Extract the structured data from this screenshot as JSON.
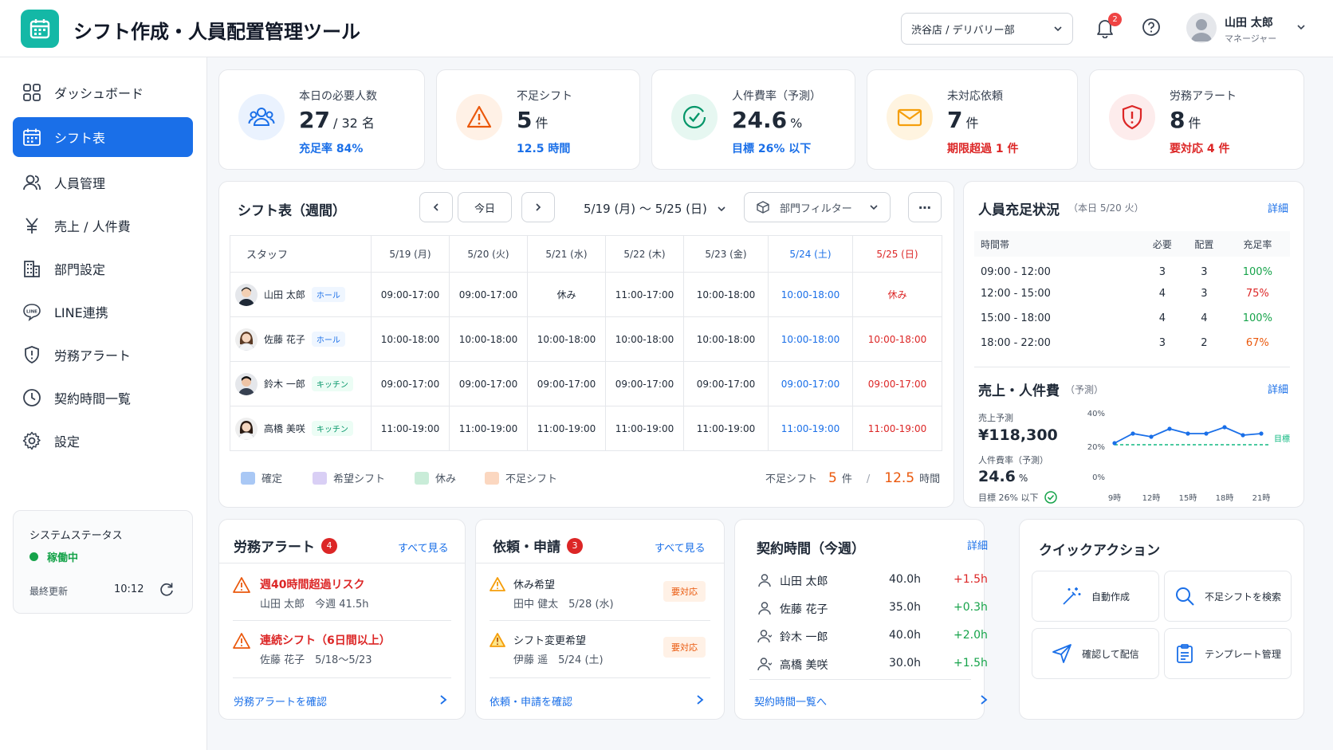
{
  "header": {
    "title": "シフト作成・人員配置管理ツール",
    "store": "渋谷店 / デリバリー部",
    "notification_count": "2",
    "user_name": "山田 太郎",
    "user_role": "マネージャー"
  },
  "sidebar": {
    "items": [
      {
        "label": "ダッシュボード",
        "icon": "dashboard-icon"
      },
      {
        "label": "シフト表",
        "icon": "calendar-icon",
        "active": true
      },
      {
        "label": "人員管理",
        "icon": "users-icon"
      },
      {
        "label": "売上 / 人件費",
        "icon": "yen-icon"
      },
      {
        "label": "部門設定",
        "icon": "building-icon"
      },
      {
        "label": "LINE連携",
        "icon": "line-icon"
      },
      {
        "label": "労務アラート",
        "icon": "shield-icon"
      },
      {
        "label": "契約時間一覧",
        "icon": "clock-icon"
      },
      {
        "label": "設定",
        "icon": "gear-icon"
      }
    ],
    "system": {
      "title": "システムステータス",
      "status": "稼働中",
      "updated_label": "最終更新",
      "updated_time": "10:12"
    }
  },
  "kpis": [
    {
      "label": "本日の必要人数",
      "value": "27",
      "unit": "/ 32 名",
      "sub": "充足率 84%",
      "color": "#1a6fe8",
      "icon": "users-icon"
    },
    {
      "label": "不足シフト",
      "value": "5",
      "unit": "件",
      "sub": "12.5 時間",
      "color": "#1a6fe8",
      "icon": "warning-icon"
    },
    {
      "label": "人件費率（予測）",
      "value": "24.6",
      "unit": "%",
      "sub": "目標 26% 以下",
      "color": "#1a6fe8",
      "icon": "check-badge-icon"
    },
    {
      "label": "未対応依頼",
      "value": "7",
      "unit": "件",
      "sub": "期限超過 1 件",
      "color": "#dc2626",
      "icon": "mail-icon"
    },
    {
      "label": "労務アラート",
      "value": "8",
      "unit": "件",
      "sub": "要対応 4 件",
      "color": "#dc2626",
      "icon": "shield-alert-icon"
    }
  ],
  "schedule": {
    "title": "シフト表（週間）",
    "today": "今日",
    "range": "5/19 (月) 〜 5/25 (日)",
    "filter": "部門フィルター",
    "columns": [
      "スタッフ",
      "5/19 (月)",
      "5/20 (火)",
      "5/21 (水)",
      "5/22 (木)",
      "5/23 (金)",
      "5/24 (土)",
      "5/25 (日)"
    ],
    "rows": [
      {
        "name": "山田 太郎",
        "dept": "ホール",
        "shifts": [
          "09:00-17:00",
          "09:00-17:00",
          "休み",
          "11:00-17:00",
          "10:00-18:00",
          "10:00-18:00",
          "休み"
        ]
      },
      {
        "name": "佐藤 花子",
        "dept": "ホール",
        "shifts": [
          "10:00-18:00",
          "10:00-18:00",
          "10:00-18:00",
          "10:00-18:00",
          "10:00-18:00",
          "10:00-18:00",
          "10:00-18:00"
        ]
      },
      {
        "name": "鈴木 一郎",
        "dept": "キッチン",
        "shifts": [
          "09:00-17:00",
          "09:00-17:00",
          "09:00-17:00",
          "09:00-17:00",
          "09:00-17:00",
          "09:00-17:00",
          "09:00-17:00"
        ]
      },
      {
        "name": "高橋 美咲",
        "dept": "キッチン",
        "shifts": [
          "11:00-19:00",
          "11:00-19:00",
          "11:00-19:00",
          "11:00-19:00",
          "11:00-19:00",
          "11:00-19:00",
          "11:00-19:00"
        ]
      }
    ],
    "legend": [
      {
        "label": "確定",
        "color": "#a9c8f5"
      },
      {
        "label": "希望シフト",
        "color": "#d9cff5"
      },
      {
        "label": "休み",
        "color": "#c9ecd8"
      },
      {
        "label": "不足シフト",
        "color": "#fbd7c0"
      }
    ],
    "shortage_label": "不足シフト",
    "shortage_count": "5",
    "shortage_count_unit": "件",
    "shortage_hours": "12.5",
    "shortage_hours_unit": "時間"
  },
  "staffing": {
    "title": "人員充足状況",
    "date": "（本日 5/20 火）",
    "detail": "詳細",
    "columns": [
      "時間帯",
      "必要",
      "配置",
      "充足率"
    ],
    "rows": [
      {
        "time": "09:00 - 12:00",
        "need": "3",
        "placed": "3",
        "rate": "100%",
        "ok": true
      },
      {
        "time": "12:00 - 15:00",
        "need": "4",
        "placed": "3",
        "rate": "75%",
        "ok": false
      },
      {
        "time": "15:00 - 18:00",
        "need": "4",
        "placed": "4",
        "rate": "100%",
        "ok": true
      },
      {
        "time": "18:00 - 22:00",
        "need": "3",
        "placed": "2",
        "rate": "67%",
        "ok": false
      }
    ]
  },
  "sales": {
    "title": "売上・人件費",
    "sub": "（予測）",
    "detail": "詳細",
    "forecast_label": "売上予測",
    "forecast": "¥118,300",
    "ratio_label": "人件費率（予測）",
    "ratio": "24.6",
    "ratio_unit": "%",
    "target": "目標 26% 以下",
    "chart_data": {
      "type": "line",
      "x": [
        "9時",
        "12時",
        "15時",
        "18時",
        "21時"
      ],
      "yticks": [
        "40%",
        "20%",
        "0%"
      ],
      "ylim": [
        0,
        40
      ],
      "series": [
        {
          "values": [
            21,
            27,
            25,
            30,
            27,
            27,
            31,
            26,
            27
          ],
          "color": "#1a6fe8"
        }
      ],
      "target": {
        "name": "目標",
        "value": 20
      }
    }
  },
  "labor_alerts": {
    "title": "労務アラート",
    "count": "4",
    "see_all": "すべて見る",
    "items": [
      {
        "title": "週40時間超過リスク",
        "sub": "山田 太郎　今週 41.5h"
      },
      {
        "title": "連続シフト（6日間以上）",
        "sub": "佐藤 花子　5/18〜5/23"
      }
    ],
    "footer": "労務アラートを確認"
  },
  "requests": {
    "title": "依頼・申請",
    "count": "3",
    "see_all": "すべて見る",
    "items": [
      {
        "title": "休み希望",
        "sub": "田中 健太　5/28 (水)",
        "badge": "要対応"
      },
      {
        "title": "シフト変更希望",
        "sub": "伊藤 遥　5/24 (土)",
        "badge": "要対応"
      }
    ],
    "footer": "依頼・申請を確認"
  },
  "contract": {
    "title": "契約時間（今週）",
    "detail": "詳細",
    "rows": [
      {
        "name": "山田 太郎",
        "hours": "40.0h",
        "diff": "+1.5h"
      },
      {
        "name": "佐藤 花子",
        "hours": "35.0h",
        "diff": "+0.3h"
      },
      {
        "name": "鈴木 一郎",
        "hours": "40.0h",
        "diff": "+2.0h"
      },
      {
        "name": "高橋 美咲",
        "hours": "30.0h",
        "diff": "+1.5h"
      }
    ],
    "footer": "契約時間一覧へ"
  },
  "quick": {
    "title": "クイックアクション",
    "actions": [
      {
        "label": "自動作成",
        "icon": "magic-wand-icon"
      },
      {
        "label": "不足シフトを検索",
        "icon": "search-icon"
      },
      {
        "label": "確認して配信",
        "icon": "send-icon"
      },
      {
        "label": "テンプレート管理",
        "icon": "clipboard-icon"
      }
    ]
  }
}
